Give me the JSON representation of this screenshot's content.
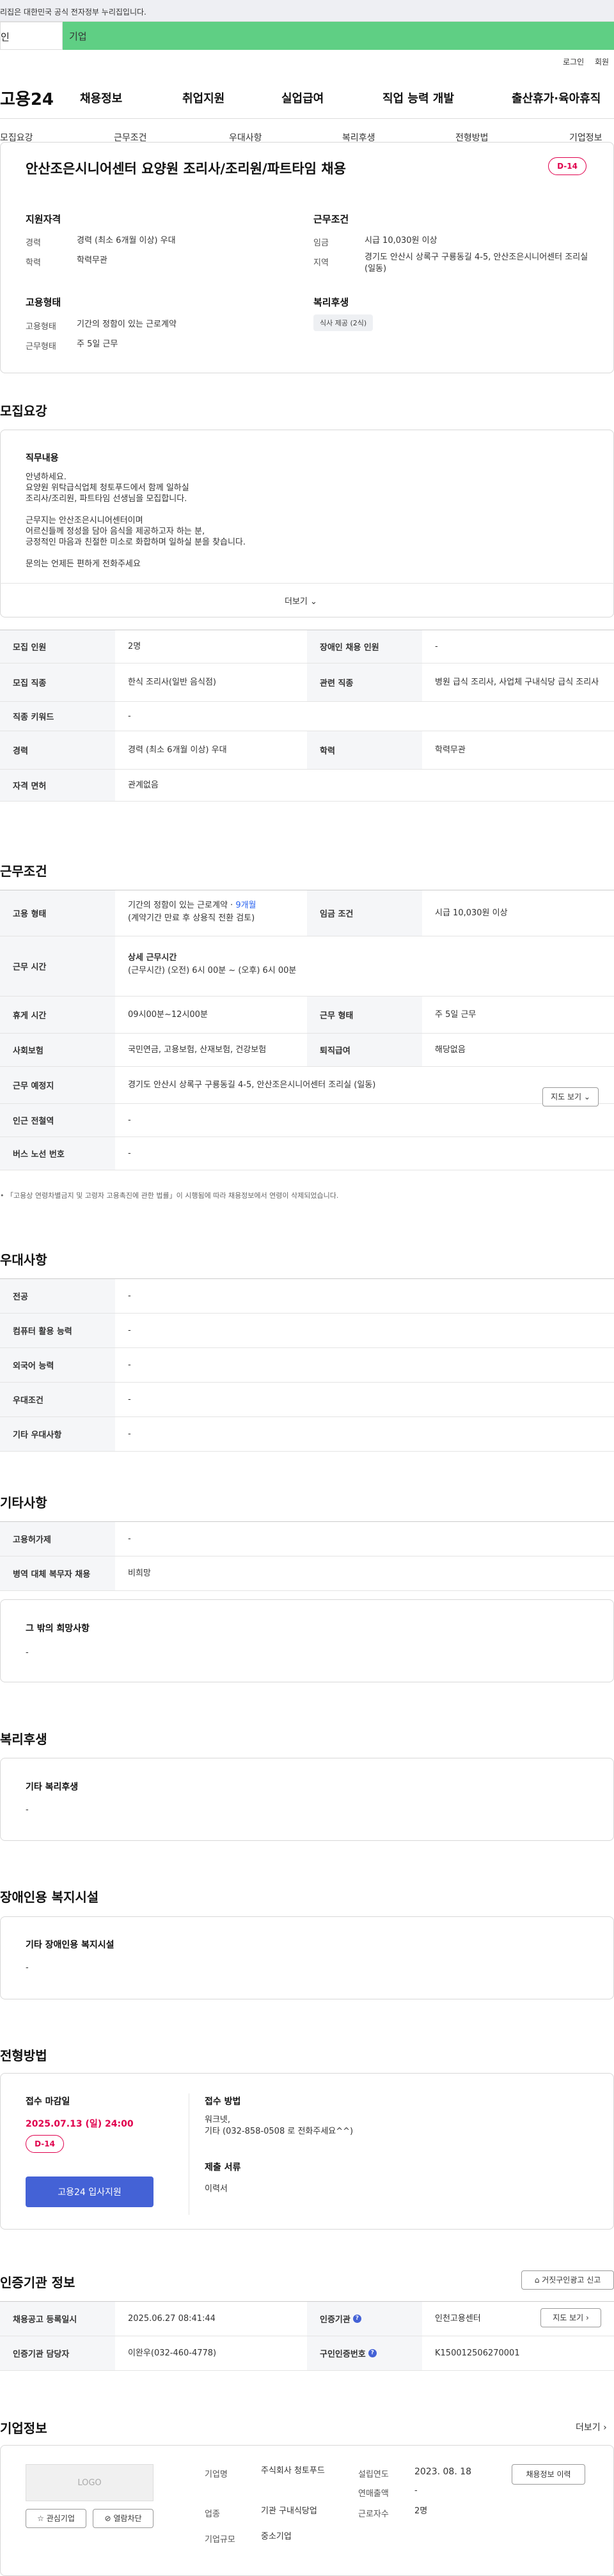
{
  "gov_banner": "리집은 대한민국 공식 전자정부 누리집입니다.",
  "tabs": {
    "individual": "인",
    "company": "기업"
  },
  "util": {
    "login": "로그인",
    "signup": "회원"
  },
  "logo": "고용24",
  "main_nav": [
    "채용정보",
    "취업지원",
    "실업급여",
    "직업 능력 개발",
    "출산휴가·육아휴직"
  ],
  "sub_nav": [
    "모집요강",
    "근무조건",
    "우대사항",
    "복리후생",
    "전형방법",
    "기업정보"
  ],
  "job": {
    "title": "안산조은시니어센터 요양원 조리사/조리원/파트타임 채용",
    "dday": "D-14",
    "qual_title": "지원자격",
    "qual": [
      {
        "label": "경력",
        "value": "경력 (최소 6개월 이상) 우대"
      },
      {
        "label": "학력",
        "value": "학력무관"
      }
    ],
    "cond_title": "근무조건",
    "cond": [
      {
        "label": "임금",
        "value": "시급 10,030원 이상"
      },
      {
        "label": "지역",
        "value": "경기도 안산시 상록구 구룡동길 4-5, 안산조은시니어센터 조리실 (일동)"
      }
    ],
    "emp_title": "고용형태",
    "emp": [
      {
        "label": "고용형태",
        "value": "기간의 정함이 있는 근로계약"
      },
      {
        "label": "근무형태",
        "value": "주 5일 근무"
      }
    ],
    "welfare_title": "복리후생",
    "welfare_tag": "식사 제공 (2식)"
  },
  "recruit": {
    "heading": "모집요강",
    "duty_title": "직무내용",
    "duty_lines": [
      "안녕하세요.",
      "요양원 위탁급식업체 청토푸드에서 함께 일하실",
      "조리사/조리원, 파트타임 선생님을 모집합니다.",
      "",
      "근무지는 안산조은시니어센터이며",
      "어르신들께 정성을 담아 음식을 제공하고자 하는 분,",
      "긍정적인 마음과 친절한 미소로 화합하며 일하실 분을 찾습니다.",
      "",
      "문의는 언제든 편하게 전화주세요"
    ],
    "more": "더보기",
    "rows": [
      [
        "모집 인원",
        "2명",
        "장애인 채용 인원",
        "-"
      ],
      [
        "모집 직종",
        "한식 조리사(일반 음식점)",
        "관련 직종",
        "병원 급식 조리사, 사업체 구내식당 급식 조리사"
      ],
      [
        "직종 키워드",
        "-"
      ],
      [
        "경력",
        "경력 (최소 6개월 이상) 우대",
        "학력",
        "학력무관"
      ],
      [
        "자격 면허",
        "관계없음"
      ]
    ]
  },
  "work": {
    "heading": "근무조건",
    "emp_label": "고용 형태",
    "emp_value": "기간의 정함이 있는 근로계약 ·",
    "emp_months": "9개월",
    "emp_note": "(계약기간 만료 후 상용직 전환 검토)",
    "wage_label": "임금 조건",
    "wage_value": "시급 10,030원 이상",
    "hours_label": "근무 시간",
    "hours_title": "상세 근무시간",
    "hours_value": "(근무시간) (오전) 6시 00분 ~ (오후) 6시 00분",
    "rest_label": "휴게 시간",
    "rest_value": "09시00분~12시00분",
    "form_label": "근무 형태",
    "form_value": "주 5일 근무",
    "ins_label": "사회보험",
    "ins_value": "국민연금, 고용보험, 산재보험, 건강보험",
    "ret_label": "퇴직급여",
    "ret_value": "해당없음",
    "place_label": "근무 예정지",
    "place_value": "경기도 안산시 상록구 구룡동길 4-5, 안산조은시니어센터 조리실 (일동)",
    "map_btn": "지도 보기",
    "subway_label": "인근 전철역",
    "subway_value": "-",
    "bus_label": "버스 노선 번호",
    "bus_value": "-",
    "footnote": "「고용상 연령차별금지 및 고령자 고용촉진에 관한 법률」이 시행됨에 따라 채용정보에서 연령이 삭제되었습니다."
  },
  "pref": {
    "heading": "우대사항",
    "rows": [
      [
        "전공",
        "-"
      ],
      [
        "컴퓨터 활용 능력",
        "-"
      ],
      [
        "외국어 능력",
        "-"
      ],
      [
        "우대조건",
        "-"
      ],
      [
        "기타 우대사항",
        "-"
      ]
    ]
  },
  "etc": {
    "heading": "기타사항",
    "rows": [
      [
        "고용허가제",
        "-"
      ],
      [
        "병역 대체 복무자 채용",
        "비희망"
      ]
    ],
    "other_title": "그 밖의 희망사항",
    "other_value": "-"
  },
  "welfare": {
    "heading": "복리후생",
    "title": "기타 복리후생",
    "value": "-"
  },
  "disabled": {
    "heading": "장애인용 복지시설",
    "title": "기타 장애인용 복지시설",
    "value": "-"
  },
  "screening": {
    "heading": "전형방법",
    "deadline_title": "접수 마감일",
    "deadline": "2025.07.13 (일) 24:00",
    "dday": "D-14",
    "apply_btn": "고용24 입사지원",
    "method_title": "접수 방법",
    "method_lines": [
      "워크넷,",
      "기타 (032-858-0508 로 전화주세요^^)"
    ],
    "docs_title": "제출 서류",
    "docs_value": "이력서"
  },
  "agency": {
    "heading": "인증기관 정보",
    "report_btn": "거짓구인광고 신고",
    "reg_label": "채용공고 등록일시",
    "reg_value": "2025.06.27 08:41:44",
    "org_label": "인증기관",
    "org_value": "인천고용센터",
    "map_btn": "지도 보기",
    "mgr_label": "인증기관 담당자",
    "mgr_value": "이완우(032-460-4778)",
    "id_label": "구인인증번호",
    "id_value": "K150012506270001"
  },
  "company": {
    "heading": "기업정보",
    "more": "더보기",
    "logo": "LOGO",
    "fav_btn": "관심기업",
    "block_btn": "열람차단",
    "name_label": "기업명",
    "name_value": "주식회사 청토푸드",
    "ind_label": "업종",
    "ind_value": "기관 구내식당업",
    "scale_label": "기업규모",
    "scale_value": "중소기업",
    "est_label": "설립연도",
    "est_value": "2023. 08. 18",
    "sales_label": "연매출액",
    "sales_value": "-",
    "staff_label": "근로자수",
    "staff_value": "2명",
    "history_btn": "채용정보 이력"
  },
  "colors": {
    "accent_green": "#5fcf84",
    "dday_pink": "#e0004d",
    "apply_blue": "#4462d6"
  }
}
